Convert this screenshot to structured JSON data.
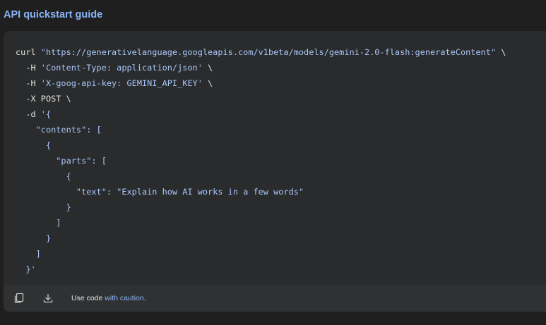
{
  "header": {
    "title": "API quickstart guide"
  },
  "code": {
    "lines": [
      [
        {
          "t": "plain",
          "v": "curl "
        },
        {
          "t": "str",
          "v": "\"https://generativelanguage.googleapis.com/v1beta/models/gemini-2.0-flash:generateContent\""
        },
        {
          "t": "plain",
          "v": " \\"
        }
      ],
      [
        {
          "t": "plain",
          "v": "  -H "
        },
        {
          "t": "str",
          "v": "'Content-Type: application/json'"
        },
        {
          "t": "plain",
          "v": " \\"
        }
      ],
      [
        {
          "t": "plain",
          "v": "  -H "
        },
        {
          "t": "str",
          "v": "'X-goog-api-key: GEMINI_API_KEY'"
        },
        {
          "t": "plain",
          "v": " \\"
        }
      ],
      [
        {
          "t": "plain",
          "v": "  -X POST \\"
        }
      ],
      [
        {
          "t": "plain",
          "v": "  -d "
        },
        {
          "t": "str",
          "v": "'{"
        }
      ],
      [
        {
          "t": "str",
          "v": "    \"contents\": ["
        }
      ],
      [
        {
          "t": "str",
          "v": "      {"
        }
      ],
      [
        {
          "t": "str",
          "v": "        \"parts\": ["
        }
      ],
      [
        {
          "t": "str",
          "v": "          {"
        }
      ],
      [
        {
          "t": "str",
          "v": "            \"text\": \"Explain how AI works in a few words\""
        }
      ],
      [
        {
          "t": "str",
          "v": "          }"
        }
      ],
      [
        {
          "t": "str",
          "v": "        ]"
        }
      ],
      [
        {
          "t": "str",
          "v": "      }"
        }
      ],
      [
        {
          "t": "str",
          "v": "    ]"
        }
      ],
      [
        {
          "t": "str",
          "v": "  }'"
        }
      ]
    ]
  },
  "footer": {
    "copy_icon": "copy-icon",
    "download_icon": "download-icon",
    "caution_prefix": "Use code ",
    "caution_link": "with caution",
    "caution_suffix": "."
  },
  "colors": {
    "background": "#1f1f1f",
    "code_background": "#2a2b2c",
    "footer_background": "#303133",
    "accent": "#8ab4f8",
    "string": "#a8c7fa",
    "text": "#e3e3e3"
  }
}
